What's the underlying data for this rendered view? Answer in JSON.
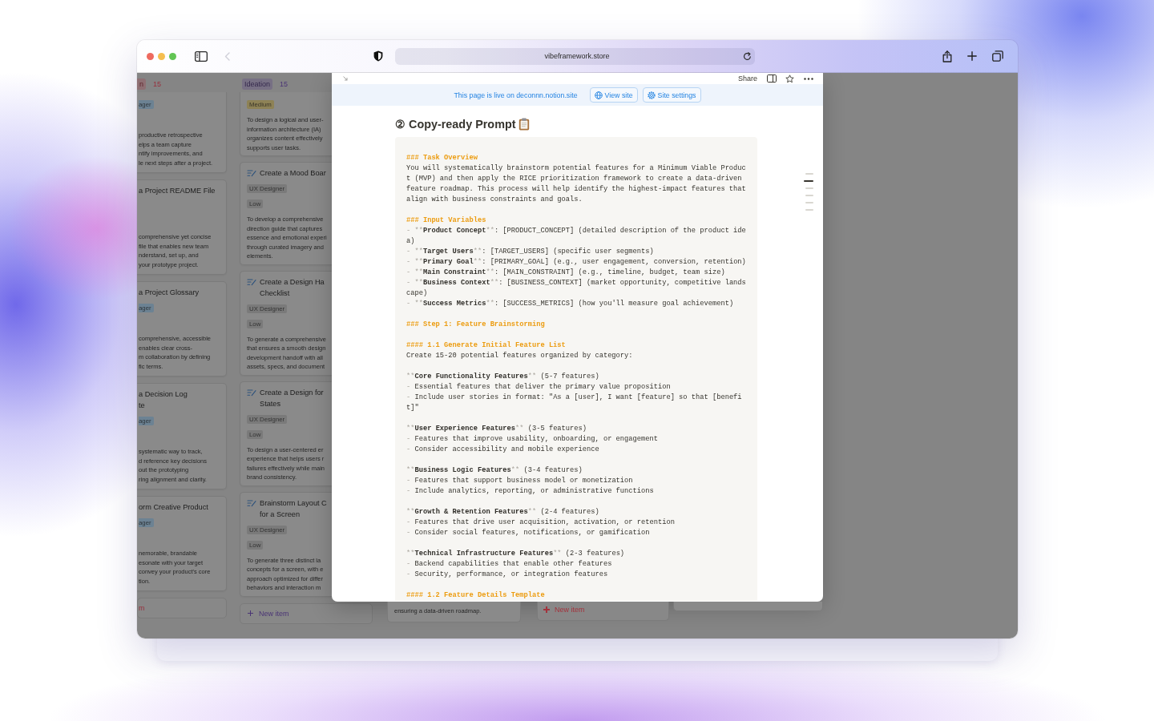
{
  "browser": {
    "url": "vibeframework.store"
  },
  "board": {
    "columns": [
      {
        "tag": "n",
        "count": "15",
        "color": "#982f3d",
        "cards": [
          {
            "tags": [
              {
                "kind": "role",
                "text": "ager",
                "color": "#6c8293"
              }
            ],
            "description": [
              "productive retrospective",
              "elps a team capture",
              "ntify improvements, and",
              "le next steps after a project."
            ]
          },
          {
            "title": [
              "a Project README File"
            ],
            "description": [
              "comprehensive yet concise",
              "file that enables new team",
              "nderstand, set up, and",
              "your prototype project."
            ]
          },
          {
            "title": [
              "a Project Glossary"
            ],
            "tags": [
              {
                "kind": "role",
                "text": "ager",
                "color": "#6c8293"
              }
            ],
            "description": [
              "comprehensive, accessible",
              "enables clear cross-",
              "m collaboration by defining",
              "fic terms."
            ]
          },
          {
            "title": [
              "a Decision Log",
              "te"
            ],
            "tags": [
              {
                "kind": "role",
                "text": "ager",
                "color": "#6c8293"
              }
            ],
            "description": [
              "systematic way to track,",
              "d reference key decisions",
              "out the prototyping",
              "ring alignment and clarity."
            ]
          },
          {
            "title": [
              "orm Creative Product"
            ],
            "tags": [
              {
                "kind": "role",
                "text": "ager",
                "color": "#6c8293"
              }
            ],
            "description": [
              "nemorable, brandable",
              "esonate with your target",
              "convey your product's core",
              "tion."
            ]
          }
        ],
        "new_item": {
          "label": "m",
          "has_icon": false
        }
      },
      {
        "tag": "Ideation",
        "count": "15",
        "color": "#4a3475",
        "cards": [
          {
            "tags": [
              {
                "kind": "priority",
                "text": "Medium",
                "color": "#8e8256"
              }
            ],
            "description": [
              "To design a logical and user-",
              "information architecture (IA)",
              "organizes content effectively",
              "supports user tasks."
            ]
          },
          {
            "icon": true,
            "title": [
              "Create a Mood Boar"
            ],
            "tags": [
              {
                "kind": "role",
                "text": "UX Designer",
                "color": "#7a7a7a"
              },
              {
                "kind": "priority",
                "text": "Low",
                "color": "#7a7a7a"
              }
            ],
            "description": [
              "To develop a comprehensive",
              "direction guide that captures",
              "essence and emotional experi",
              "through curated imagery and",
              "elements."
            ]
          },
          {
            "icon": true,
            "title": [
              "Create a Design Ha",
              "Checklist"
            ],
            "tags": [
              {
                "kind": "role",
                "text": "UX Designer",
                "color": "#7a7a7a"
              },
              {
                "kind": "priority",
                "text": "Low",
                "color": "#7a7a7a"
              }
            ],
            "description": [
              "To generate a comprehensive",
              "that ensures a smooth design",
              "development handoff with all",
              "assets, specs, and document"
            ]
          },
          {
            "icon": true,
            "title": [
              "Create a Design for",
              "States"
            ],
            "tags": [
              {
                "kind": "role",
                "text": "UX Designer",
                "color": "#7a7a7a"
              },
              {
                "kind": "priority",
                "text": "Low",
                "color": "#7a7a7a"
              }
            ],
            "description": [
              "To design a user-centered er",
              "experience that helps users r",
              "failures effectively while main",
              "brand consistency."
            ]
          },
          {
            "icon": true,
            "title": [
              "Brainstorm Layout C",
              "for a Screen"
            ],
            "tags": [
              {
                "kind": "role",
                "text": "UX Designer",
                "color": "#7a7a7a"
              },
              {
                "kind": "priority",
                "text": "Low",
                "color": "#7a7a7a"
              }
            ],
            "description": [
              "To generate three distinct la",
              "concepts for a screen, with e",
              "approach optimized for differ",
              "behaviors and interaction m"
            ]
          }
        ],
        "new_item": {
          "label": "New item",
          "has_icon": true
        }
      }
    ],
    "lower_cards": [
      {
        "kind": "card",
        "text": "ensuring a data-driven roadmap."
      },
      {
        "kind": "new_item",
        "label": "New item",
        "color": "#a3323c"
      },
      {
        "kind": "card"
      }
    ]
  },
  "modal": {
    "share": "Share",
    "banner": {
      "text": "This page is live on deconnn.notion.site",
      "buttons": [
        {
          "kind": "view",
          "label": "View site"
        },
        {
          "kind": "settings",
          "label": "Site settings"
        }
      ]
    },
    "title": "② Copy-ready Prompt",
    "prompt": [
      [
        [
          {
            "kind": "heading",
            "text": "### Task Overview"
          }
        ],
        [
          {
            "kind": "plain",
            "text": "You will systematically brainstorm potential features for a Minimum Viable Product (MVP) and then apply the RICE prioritization framework to create a data-driven feature roadmap. This process will help identify the highest-impact features that align with business constraints and goals."
          }
        ]
      ],
      [
        [
          {
            "kind": "heading",
            "text": "### Input Variables"
          }
        ],
        [
          {
            "kind": "mark",
            "text": "- **"
          },
          {
            "kind": "strong",
            "text": "Product Concept"
          },
          {
            "kind": "mark",
            "text": "**"
          },
          {
            "kind": "plain",
            "text": ": [PRODUCT_CONCEPT] (detailed description of the product idea)"
          }
        ],
        [
          {
            "kind": "mark",
            "text": "- **"
          },
          {
            "kind": "strong",
            "text": "Target Users"
          },
          {
            "kind": "mark",
            "text": "**"
          },
          {
            "kind": "plain",
            "text": ": [TARGET_USERS] (specific user segments)"
          }
        ],
        [
          {
            "kind": "mark",
            "text": "- **"
          },
          {
            "kind": "strong",
            "text": "Primary Goal"
          },
          {
            "kind": "mark",
            "text": "**"
          },
          {
            "kind": "plain",
            "text": ": [PRIMARY_GOAL] (e.g., user engagement, conversion, retention)"
          }
        ],
        [
          {
            "kind": "mark",
            "text": "- **"
          },
          {
            "kind": "strong",
            "text": "Main Constraint"
          },
          {
            "kind": "mark",
            "text": "**"
          },
          {
            "kind": "plain",
            "text": ": [MAIN_CONSTRAINT] (e.g., timeline, budget, team size)"
          }
        ],
        [
          {
            "kind": "mark",
            "text": "- **"
          },
          {
            "kind": "strong",
            "text": "Business Context"
          },
          {
            "kind": "mark",
            "text": "**"
          },
          {
            "kind": "plain",
            "text": ": [BUSINESS_CONTEXT] (market opportunity, competitive landscape)"
          }
        ],
        [
          {
            "kind": "mark",
            "text": "- **"
          },
          {
            "kind": "strong",
            "text": "Success Metrics"
          },
          {
            "kind": "mark",
            "text": "**"
          },
          {
            "kind": "plain",
            "text": ": [SUCCESS_METRICS] (how you'll measure goal achievement)"
          }
        ]
      ],
      [
        [
          {
            "kind": "heading",
            "text": "### Step 1: Feature Brainstorming"
          }
        ]
      ],
      [
        [
          {
            "kind": "heading",
            "text": "#### 1.1 Generate Initial Feature List"
          }
        ],
        [
          {
            "kind": "plain",
            "text": "Create 15-20 potential features organized by category:"
          }
        ]
      ],
      [
        [
          {
            "kind": "mark",
            "text": "**"
          },
          {
            "kind": "strong",
            "text": "Core Functionality Features"
          },
          {
            "kind": "mark",
            "text": "**"
          },
          {
            "kind": "plain",
            "text": " (5-7 features)"
          }
        ],
        [
          {
            "kind": "mark",
            "text": "- "
          },
          {
            "kind": "plain",
            "text": "Essential features that deliver the primary value proposition"
          }
        ],
        [
          {
            "kind": "mark",
            "text": "- "
          },
          {
            "kind": "plain",
            "text": "Include user stories in format: \"As a [user], I want [feature] so that [benefit]\""
          }
        ]
      ],
      [
        [
          {
            "kind": "mark",
            "text": "**"
          },
          {
            "kind": "strong",
            "text": "User Experience Features"
          },
          {
            "kind": "mark",
            "text": "**"
          },
          {
            "kind": "plain",
            "text": " (3-5 features)"
          }
        ],
        [
          {
            "kind": "mark",
            "text": "- "
          },
          {
            "kind": "plain",
            "text": "Features that improve usability, onboarding, or engagement"
          }
        ],
        [
          {
            "kind": "mark",
            "text": "- "
          },
          {
            "kind": "plain",
            "text": "Consider accessibility and mobile experience"
          }
        ]
      ],
      [
        [
          {
            "kind": "mark",
            "text": "**"
          },
          {
            "kind": "strong",
            "text": "Business Logic Features"
          },
          {
            "kind": "mark",
            "text": "**"
          },
          {
            "kind": "plain",
            "text": " (3-4 features)"
          }
        ],
        [
          {
            "kind": "mark",
            "text": "- "
          },
          {
            "kind": "plain",
            "text": "Features that support business model or monetization"
          }
        ],
        [
          {
            "kind": "mark",
            "text": "- "
          },
          {
            "kind": "plain",
            "text": "Include analytics, reporting, or administrative functions"
          }
        ]
      ],
      [
        [
          {
            "kind": "mark",
            "text": "**"
          },
          {
            "kind": "strong",
            "text": "Growth & Retention Features"
          },
          {
            "kind": "mark",
            "text": "**"
          },
          {
            "kind": "plain",
            "text": " (2-4 features)"
          }
        ],
        [
          {
            "kind": "mark",
            "text": "- "
          },
          {
            "kind": "plain",
            "text": "Features that drive user acquisition, activation, or retention"
          }
        ],
        [
          {
            "kind": "mark",
            "text": "- "
          },
          {
            "kind": "plain",
            "text": "Consider social features, notifications, or gamification"
          }
        ]
      ],
      [
        [
          {
            "kind": "mark",
            "text": "**"
          },
          {
            "kind": "strong",
            "text": "Technical Infrastructure Features"
          },
          {
            "kind": "mark",
            "text": "**"
          },
          {
            "kind": "plain",
            "text": " (2-3 features)"
          }
        ],
        [
          {
            "kind": "mark",
            "text": "- "
          },
          {
            "kind": "plain",
            "text": "Backend capabilities that enable other features"
          }
        ],
        [
          {
            "kind": "mark",
            "text": "- "
          },
          {
            "kind": "plain",
            "text": "Security, performance, or integration features"
          }
        ]
      ],
      [
        [
          {
            "kind": "heading",
            "text": "#### 1.2 Feature Details Template"
          }
        ]
      ]
    ],
    "outline": [
      {
        "selected": false
      },
      {
        "selected": true
      },
      {
        "selected": false
      },
      {
        "selected": false
      },
      {
        "selected": false
      },
      {
        "selected": false
      }
    ]
  }
}
